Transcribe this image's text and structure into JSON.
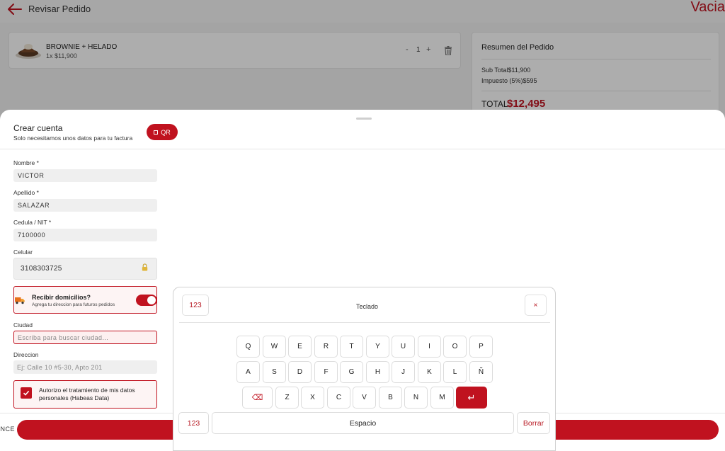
{
  "header": {
    "title": "Revisar Pedido",
    "clear_label": "Vacia"
  },
  "cart": {
    "items": [
      {
        "name": "BROWNIE + HELADO",
        "price_line": "1x $11,900",
        "qty_minus": "-",
        "quantity": "1",
        "qty_plus": "+"
      }
    ]
  },
  "summary": {
    "title": "Resumen del Pedido",
    "subtotal": "Sub Total$11,900",
    "tax": "Impuesto (5%)$595",
    "total_label": "TOTAL",
    "total_value": "$12,495"
  },
  "sheet": {
    "title": "Crear cuenta",
    "subtitle": "Solo necesitamos unos datos para tu factura",
    "qr_label": "QR",
    "fields": {
      "nombre_label": "Nombre *",
      "nombre_value": "VICTOR",
      "apellido_label": "Apellido *",
      "apellido_value": "SALAZAR",
      "cedula_label": "Cedula / NIT *",
      "cedula_value": "7100000",
      "celular_label": "Celular",
      "celular_value": "3108303725"
    },
    "delivery": {
      "title": "Recibir domicilios?",
      "subtitle": "Agrega tu direccion para futuros pedidos",
      "enabled": true
    },
    "ciudad_label": "Ciudad",
    "ciudad_placeholder": "Escriba para buscar ciudad...",
    "direccion_label": "Direccion",
    "direccion_placeholder": "Ej: Calle 10 #5-30, Apto 201",
    "consent_text": "Autorizo el tratamiento de mis datos personales (Habeas Data)",
    "consent_checked": true,
    "cancel_label": "ANCE"
  },
  "keyboard": {
    "title": "Teclado",
    "mode_label": "123",
    "close_label": "×",
    "rows": [
      [
        "Q",
        "W",
        "E",
        "R",
        "T",
        "Y",
        "U",
        "I",
        "O",
        "P"
      ],
      [
        "A",
        "S",
        "D",
        "F",
        "G",
        "H",
        "J",
        "K",
        "L",
        "Ñ"
      ],
      [
        "Z",
        "X",
        "C",
        "V",
        "B",
        "N",
        "M"
      ]
    ],
    "backspace_icon": "⌫",
    "enter_icon": "↵",
    "bottom_mode_label": "123",
    "space_label": "Espacio",
    "clear_label": "Borrar"
  },
  "colors": {
    "accent": "#c0121f"
  }
}
